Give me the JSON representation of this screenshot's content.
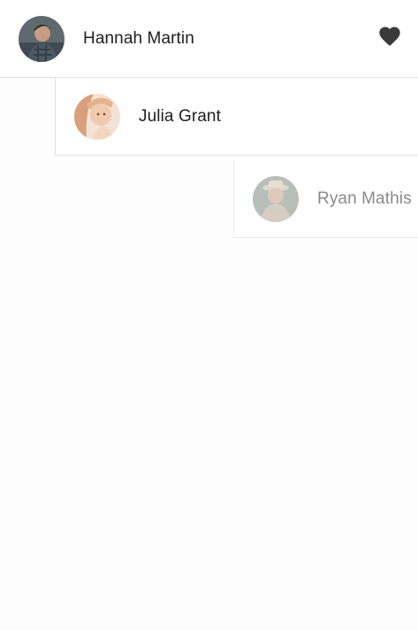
{
  "contacts": [
    {
      "name": "Hannah Martin",
      "favorite_icon": "heart-icon",
      "favorite_color": "#3a3a3a"
    },
    {
      "name": "Julia Grant"
    },
    {
      "name": "Ryan Mathis"
    }
  ]
}
